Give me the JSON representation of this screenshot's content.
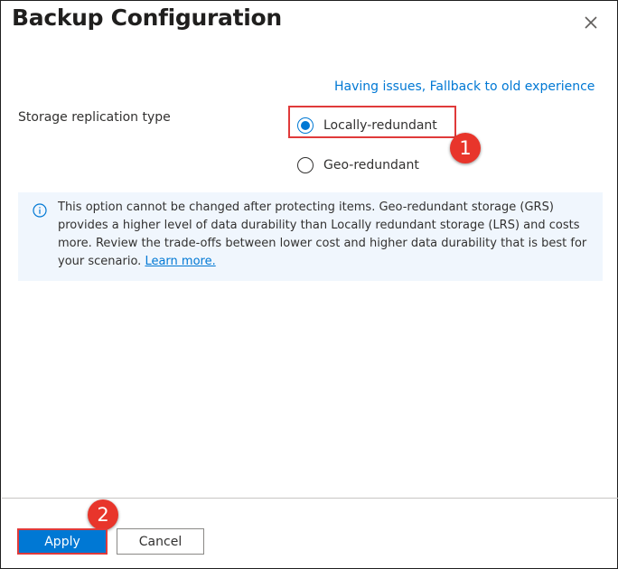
{
  "dialog": {
    "title": "Backup Configuration",
    "fallback_link": "Having issues, Fallback to old experience"
  },
  "storage": {
    "label": "Storage replication type",
    "options": [
      {
        "label": "Locally-redundant",
        "selected": true
      },
      {
        "label": "Geo-redundant",
        "selected": false
      }
    ]
  },
  "info": {
    "text": "This option cannot be changed after protecting items. Geo-redundant storage (GRS) provides a higher level of data durability than Locally redundant storage (LRS) and costs more. Review the trade-offs between lower cost and higher data durability that is best for your scenario.",
    "link": "Learn more."
  },
  "annotations": {
    "step1": "1",
    "step2": "2"
  },
  "footer": {
    "apply_label": "Apply",
    "cancel_label": "Cancel"
  },
  "colors": {
    "accent": "#0078d4",
    "highlight": "#e03a3a",
    "badge": "#e8352b",
    "info_bg": "#f0f6fd"
  }
}
